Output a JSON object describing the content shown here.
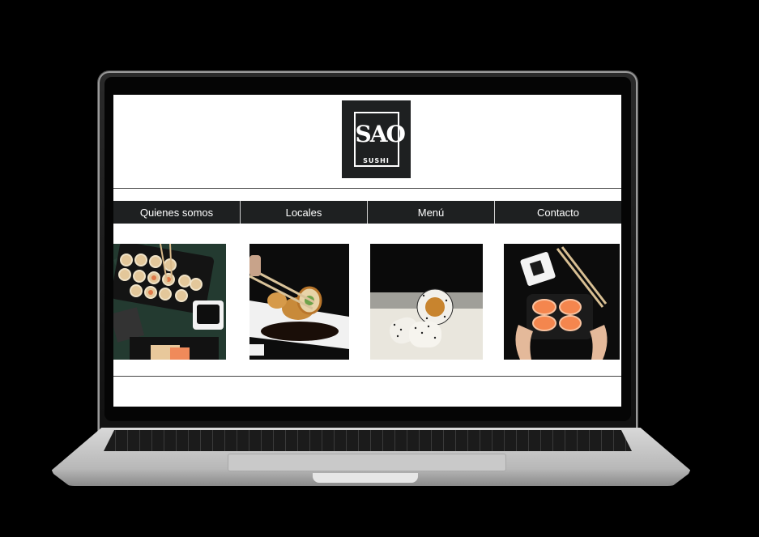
{
  "logo": {
    "mark": "SAO",
    "sub": "SUSHI"
  },
  "nav": {
    "items": [
      {
        "label": "Quienes somos"
      },
      {
        "label": "Locales"
      },
      {
        "label": "Menú"
      },
      {
        "label": "Contacto"
      }
    ]
  },
  "gallery": [
    {
      "icon": "sushi-tray-photo"
    },
    {
      "icon": "chopsticks-roll-photo"
    },
    {
      "icon": "sesame-roll-photo"
    },
    {
      "icon": "salmon-box-photo"
    }
  ],
  "colors": {
    "nav_bg": "#1e2021",
    "screen_bg": "#ffffff",
    "background": "#000000"
  }
}
